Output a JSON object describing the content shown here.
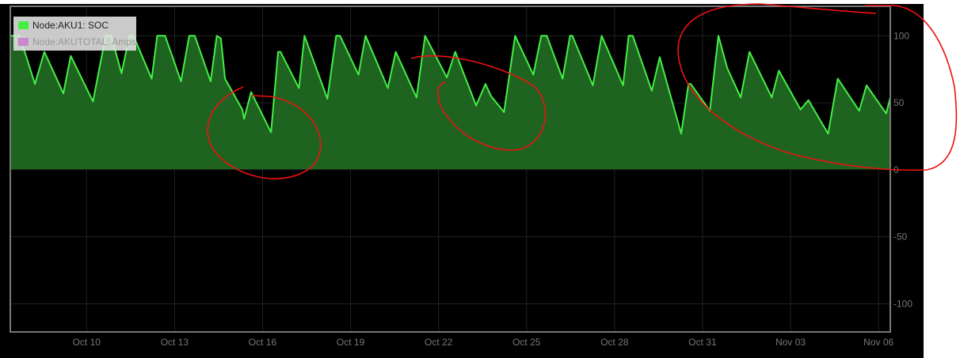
{
  "chart_data": {
    "type": "area",
    "title": "",
    "xlabel": "",
    "ylabel": "",
    "x_unit": "day (Oct 1 = 1, Nov 1 = 32)",
    "xlim": [
      7.4,
      37.4
    ],
    "ylim": [
      -121,
      122
    ],
    "grid": true,
    "legend_position": "top-left",
    "x_ticks": [
      {
        "x": 10,
        "label": "Oct 10"
      },
      {
        "x": 13,
        "label": "Oct 13"
      },
      {
        "x": 16,
        "label": "Oct 16"
      },
      {
        "x": 19,
        "label": "Oct 19"
      },
      {
        "x": 22,
        "label": "Oct 22"
      },
      {
        "x": 25,
        "label": "Oct 25"
      },
      {
        "x": 28,
        "label": "Oct 28"
      },
      {
        "x": 31,
        "label": "Oct 31"
      },
      {
        "x": 34,
        "label": "Nov 03"
      },
      {
        "x": 37,
        "label": "Nov 06"
      }
    ],
    "y_ticks": [
      {
        "y": 100,
        "label": "100"
      },
      {
        "y": 50,
        "label": "50"
      },
      {
        "y": 0,
        "label": "0"
      },
      {
        "y": -50,
        "label": "-50"
      },
      {
        "y": -100,
        "label": "-100"
      }
    ],
    "series": [
      {
        "name": "Node:AKU1: SOC",
        "color": "#44ee44",
        "fill": "#1e6420",
        "visible": true,
        "points": [
          [
            7.4,
            100
          ],
          [
            7.72,
            100
          ],
          [
            8.24,
            64
          ],
          [
            8.56,
            88
          ],
          [
            9.21,
            57
          ],
          [
            9.46,
            85
          ],
          [
            10.22,
            51
          ],
          [
            10.65,
            100
          ],
          [
            10.84,
            100
          ],
          [
            11.19,
            72
          ],
          [
            11.46,
            100
          ],
          [
            11.6,
            100
          ],
          [
            12.22,
            68
          ],
          [
            12.41,
            100
          ],
          [
            12.68,
            100
          ],
          [
            13.22,
            66
          ],
          [
            13.5,
            100
          ],
          [
            13.69,
            100
          ],
          [
            14.23,
            66
          ],
          [
            14.44,
            100
          ],
          [
            14.58,
            98
          ],
          [
            14.72,
            68
          ],
          [
            15.31,
            45
          ],
          [
            15.37,
            38
          ],
          [
            15.61,
            58
          ],
          [
            16.29,
            28
          ],
          [
            16.53,
            88
          ],
          [
            16.61,
            88
          ],
          [
            17.24,
            61
          ],
          [
            17.43,
            100
          ],
          [
            18.21,
            53
          ],
          [
            18.51,
            100
          ],
          [
            18.64,
            100
          ],
          [
            19.27,
            71
          ],
          [
            19.51,
            100
          ],
          [
            20.27,
            61
          ],
          [
            20.54,
            88
          ],
          [
            21.25,
            54
          ],
          [
            21.54,
            100
          ],
          [
            22.28,
            69
          ],
          [
            22.57,
            88
          ],
          [
            23.28,
            48
          ],
          [
            23.6,
            64
          ],
          [
            23.79,
            55
          ],
          [
            24.23,
            43
          ],
          [
            24.61,
            100
          ],
          [
            25.23,
            71
          ],
          [
            25.5,
            100
          ],
          [
            25.69,
            100
          ],
          [
            26.23,
            68
          ],
          [
            26.48,
            100
          ],
          [
            26.56,
            100
          ],
          [
            27.26,
            63
          ],
          [
            27.56,
            100
          ],
          [
            28.29,
            63
          ],
          [
            28.48,
            100
          ],
          [
            28.62,
            100
          ],
          [
            29.27,
            59
          ],
          [
            29.54,
            84
          ],
          [
            30.27,
            27
          ],
          [
            30.52,
            64
          ],
          [
            30.6,
            64
          ],
          [
            31.25,
            44
          ],
          [
            31.54,
            100
          ],
          [
            31.84,
            76
          ],
          [
            32.3,
            54
          ],
          [
            32.6,
            88
          ],
          [
            33.36,
            54
          ],
          [
            33.6,
            74
          ],
          [
            34.34,
            45
          ],
          [
            34.61,
            52
          ],
          [
            34.82,
            44
          ],
          [
            35.28,
            27
          ],
          [
            35.61,
            68
          ],
          [
            36.34,
            44
          ],
          [
            36.59,
            63
          ],
          [
            37.26,
            42
          ],
          [
            37.4,
            54
          ]
        ]
      },
      {
        "name": "Node:AKUTOTAL: Amps",
        "color": "#cc88cc",
        "visible": false,
        "points": []
      }
    ]
  },
  "legend": {
    "items": [
      {
        "label": "Node:AKU1: SOC",
        "color": "#44ee44"
      },
      {
        "label": "Node:AKUTOTAL: Amps",
        "color": "#cc88cc"
      }
    ]
  },
  "annotation_color": "#ee1111"
}
